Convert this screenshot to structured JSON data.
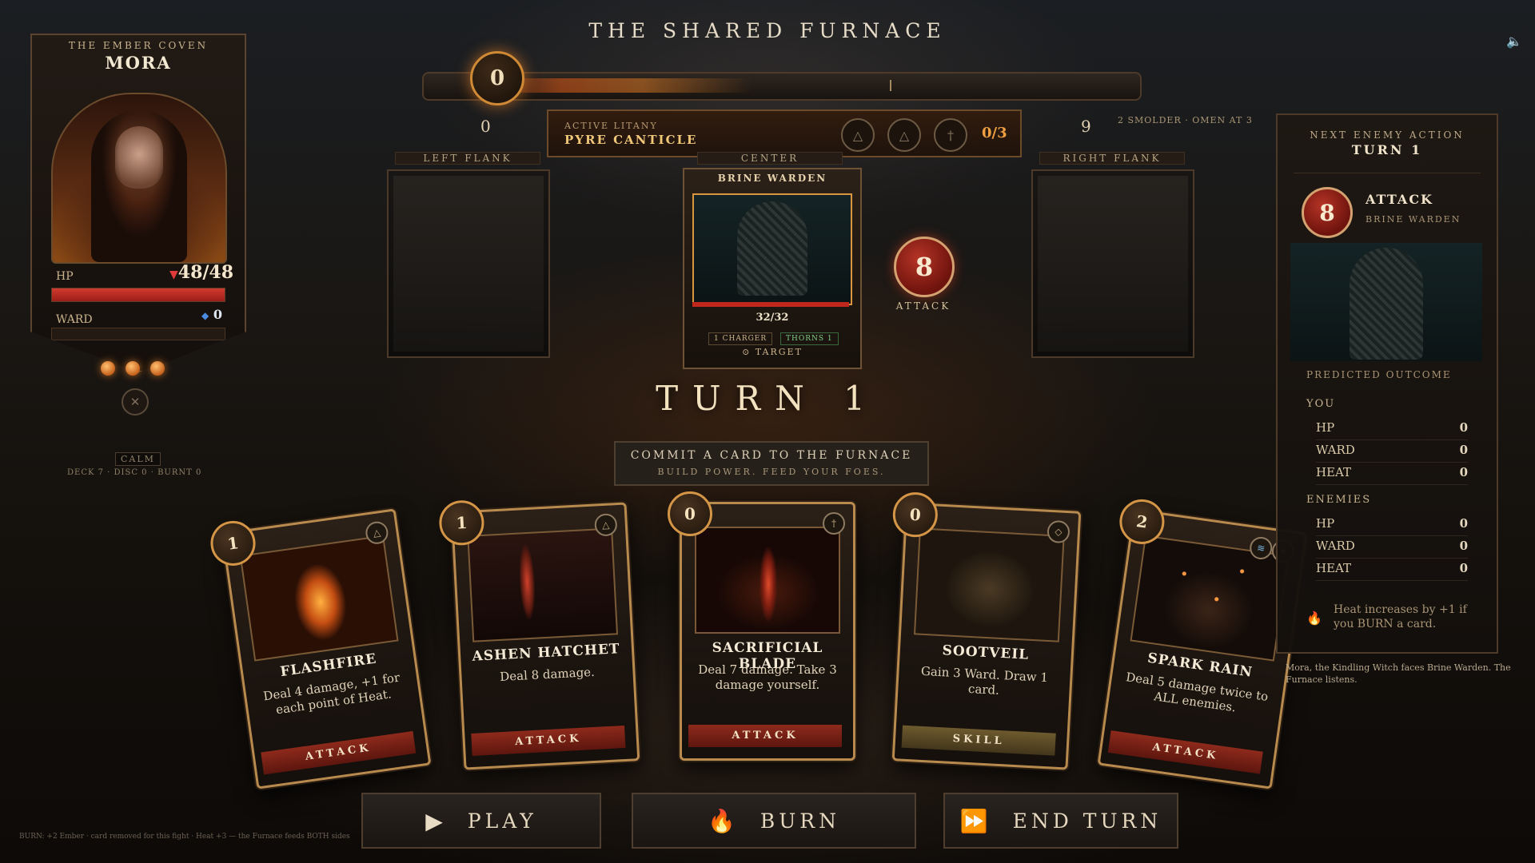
{
  "title": "THE SHARED FURNACE",
  "furnace": {
    "power": "0",
    "min_label": "0",
    "max_label": "9",
    "omen": "2 SMOLDER · OMEN AT 3"
  },
  "litany": {
    "label": "ACTIVE LITANY",
    "name": "PYRE CANTICLE",
    "runes": [
      "△",
      "△",
      "†"
    ],
    "count": "0/3"
  },
  "player": {
    "coven": "THE EMBER COVEN",
    "name": "MORA",
    "hp_label": "HP",
    "hp_value": "48/48",
    "hp_fraction": 1.0,
    "ward_label": "WARD",
    "ward_value": "0",
    "orbs": 3,
    "sigil_icon": "crossed-sigil-icon",
    "calm": "CALM",
    "deck_info": "DECK 7 · DISC 0 · BURNT 0"
  },
  "slots": {
    "left": "LEFT FLANK",
    "center": "CENTER",
    "right": "RIGHT FLANK"
  },
  "enemy": {
    "name": "BRINE WARDEN",
    "hp": "32/32",
    "hp_fraction": 1.0,
    "tags": [
      "1 CHARGER",
      "THORNS 1"
    ],
    "target": "⊙ TARGET",
    "intent_value": "8",
    "intent_label": "ATTACK"
  },
  "turn": "TURN 1",
  "commit": {
    "line1": "COMMIT A CARD TO THE FURNACE",
    "line2": "BUILD POWER. FEED YOUR FOES."
  },
  "cards": [
    {
      "cost": "1",
      "icon": "△",
      "name": "FLASHFIRE",
      "desc": "Deal 4 damage, +1 for each point of Heat.",
      "type": "ATTACK",
      "art": "flame"
    },
    {
      "cost": "1",
      "icon": "△",
      "name": "ASHEN HATCHET",
      "desc": "Deal 8 damage.",
      "type": "ATTACK",
      "art": "hatchet"
    },
    {
      "cost": "0",
      "icon": "†",
      "name": "SACRIFICIAL BLADE",
      "desc": "Deal 7 damage. Take 3 damage yourself.",
      "type": "ATTACK",
      "art": "blade"
    },
    {
      "cost": "0",
      "icon": "◇",
      "name": "SOOTVEIL",
      "desc": "Gain 3 Ward. Draw 1 card.",
      "type": "SKILL",
      "art": "veil"
    },
    {
      "cost": "2",
      "icon": "≋",
      "icon2": "✦",
      "name": "SPARK RAIN",
      "desc": "Deal 5 damage twice to ALL enemies.",
      "type": "ATTACK",
      "art": "rain"
    }
  ],
  "buttons": {
    "play": "PLAY",
    "burn": "BURN",
    "end_turn": "END TURN"
  },
  "burn_note": "BURN: +2 Ember · card removed for this fight · Heat +3 — the Furnace feeds BOTH sides",
  "next_action": {
    "heading": "NEXT ENEMY ACTION",
    "turn": "TURN 1",
    "value": "8",
    "type": "ATTACK",
    "source": "BRINE WARDEN",
    "outcome_label": "PREDICTED OUTCOME",
    "you_label": "YOU",
    "you": [
      {
        "k": "HP",
        "v": "0"
      },
      {
        "k": "WARD",
        "v": "0"
      },
      {
        "k": "HEAT",
        "v": "0"
      }
    ],
    "enemies_label": "ENEMIES",
    "enemies": [
      {
        "k": "HP",
        "v": "0"
      },
      {
        "k": "WARD",
        "v": "0"
      },
      {
        "k": "HEAT",
        "v": "0"
      }
    ],
    "heat_note": "Heat increases by +1 if you BURN a card."
  },
  "narration": "Mora, the Kindling Witch faces Brine Warden. The Furnace listens.",
  "colors": {
    "ember": "#d08a35",
    "attack": "#8e2a1c",
    "skill": "#6e5a2e",
    "hp": "#d13a2e"
  }
}
